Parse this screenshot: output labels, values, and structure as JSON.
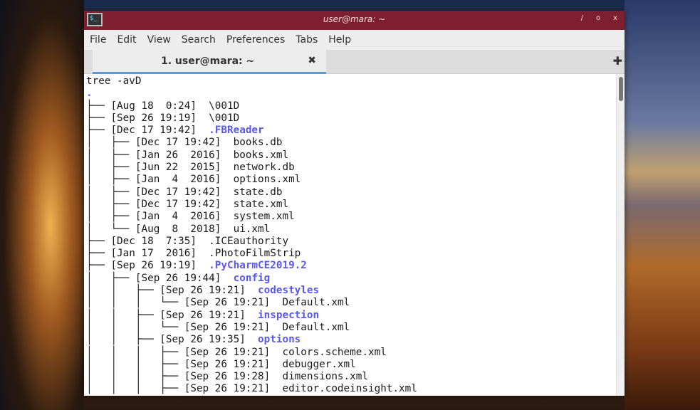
{
  "window": {
    "title": "user@mara: ~",
    "buttons": [
      "/",
      "o",
      "x"
    ]
  },
  "menu": [
    "File",
    "Edit",
    "View",
    "Search",
    "Preferences",
    "Tabs",
    "Help"
  ],
  "tab": {
    "label": "1. user@mara: ~",
    "close": "✖",
    "new": "✚"
  },
  "terminal": {
    "command": "tree -avD",
    "root": ".",
    "lines": [
      {
        "p": "├── ",
        "d": "[Aug 18  0:24]",
        "n": "\\001D",
        "dir": false
      },
      {
        "p": "├── ",
        "d": "[Sep 26 19:19]",
        "n": "\\001D",
        "dir": false
      },
      {
        "p": "├── ",
        "d": "[Dec 17 19:42]",
        "n": ".FBReader",
        "dir": true
      },
      {
        "p": "│   ├── ",
        "d": "[Dec 17 19:42]",
        "n": "books.db",
        "dir": false
      },
      {
        "p": "│   ├── ",
        "d": "[Jan 26  2016]",
        "n": "books.xml",
        "dir": false
      },
      {
        "p": "│   ├── ",
        "d": "[Jun 22  2015]",
        "n": "network.db",
        "dir": false
      },
      {
        "p": "│   ├── ",
        "d": "[Jan  4  2016]",
        "n": "options.xml",
        "dir": false
      },
      {
        "p": "│   ├── ",
        "d": "[Dec 17 19:42]",
        "n": "state.db",
        "dir": false
      },
      {
        "p": "│   ├── ",
        "d": "[Dec 17 19:42]",
        "n": "state.xml",
        "dir": false
      },
      {
        "p": "│   ├── ",
        "d": "[Jan  4  2016]",
        "n": "system.xml",
        "dir": false
      },
      {
        "p": "│   └── ",
        "d": "[Aug  8  2018]",
        "n": "ui.xml",
        "dir": false
      },
      {
        "p": "├── ",
        "d": "[Dec 18  7:35]",
        "n": ".ICEauthority",
        "dir": false
      },
      {
        "p": "├── ",
        "d": "[Jan 17  2016]",
        "n": ".PhotoFilmStrip",
        "dir": false
      },
      {
        "p": "├── ",
        "d": "[Sep 26 19:19]",
        "n": ".PyCharmCE2019.2",
        "dir": true
      },
      {
        "p": "│   ├── ",
        "d": "[Sep 26 19:44]",
        "n": "config",
        "dir": true
      },
      {
        "p": "│   │   ├── ",
        "d": "[Sep 26 19:21]",
        "n": "codestyles",
        "dir": true
      },
      {
        "p": "│   │   │   └── ",
        "d": "[Sep 26 19:21]",
        "n": "Default.xml",
        "dir": false
      },
      {
        "p": "│   │   ├── ",
        "d": "[Sep 26 19:21]",
        "n": "inspection",
        "dir": true
      },
      {
        "p": "│   │   │   └── ",
        "d": "[Sep 26 19:21]",
        "n": "Default.xml",
        "dir": false
      },
      {
        "p": "│   │   ├── ",
        "d": "[Sep 26 19:35]",
        "n": "options",
        "dir": true
      },
      {
        "p": "│   │   │   ├── ",
        "d": "[Sep 26 19:21]",
        "n": "colors.scheme.xml",
        "dir": false
      },
      {
        "p": "│   │   │   ├── ",
        "d": "[Sep 26 19:21]",
        "n": "debugger.xml",
        "dir": false
      },
      {
        "p": "│   │   │   ├── ",
        "d": "[Sep 26 19:28]",
        "n": "dimensions.xml",
        "dir": false
      },
      {
        "p": "│   │   │   ├── ",
        "d": "[Sep 26 19:21]",
        "n": "editor.codeinsight.xml",
        "dir": false
      }
    ]
  }
}
